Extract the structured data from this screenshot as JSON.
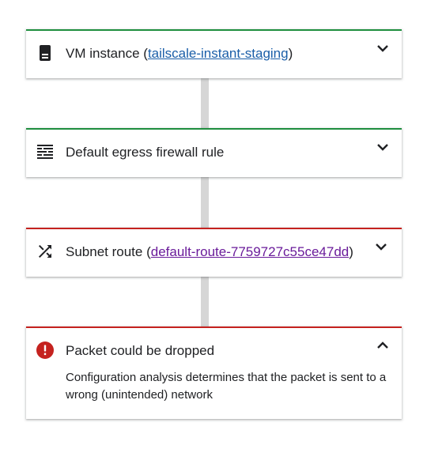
{
  "steps": [
    {
      "title_prefix": "VM instance (",
      "link_text": "tailscale-instant-staging",
      "title_suffix": ")",
      "icon": "vm-instance-icon",
      "status_color": "#1e8e3e",
      "expanded": false
    },
    {
      "title": "Default egress firewall rule",
      "icon": "firewall-rule-icon",
      "status_color": "#1e8e3e",
      "expanded": false
    },
    {
      "title_prefix": "Subnet route (",
      "link_text": "default-route-7759727c55ce47dd",
      "title_suffix": ")",
      "icon": "route-shuffle-icon",
      "status_color": "#c5221f",
      "expanded": false
    },
    {
      "title": "Packet could be dropped",
      "description": "Configuration analysis determines that the packet is sent to a wrong (unintended) network",
      "icon": "error-icon",
      "status_color": "#c5221f",
      "expanded": true
    }
  ],
  "colors": {
    "success": "#1e8e3e",
    "error": "#c5221f",
    "link": "#1a5ea8",
    "visited_link": "#6a1b9a",
    "connector": "#d6d6d6"
  }
}
